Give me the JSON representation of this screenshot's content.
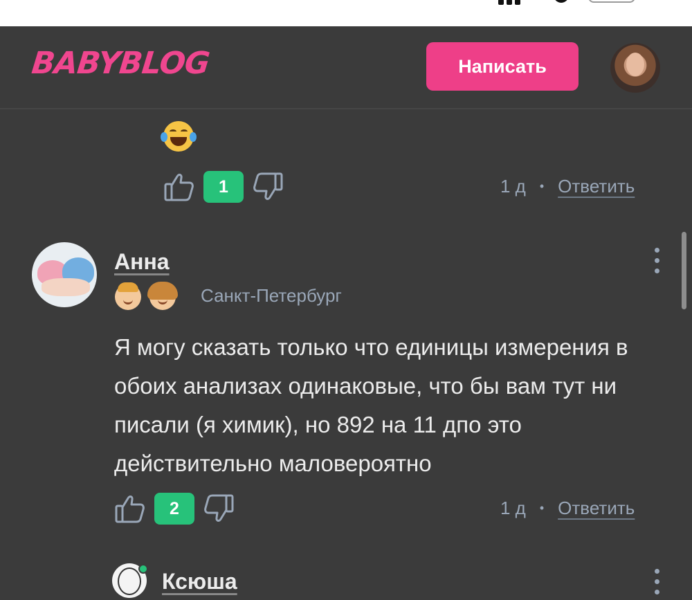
{
  "header": {
    "logo": "BABYBLOG",
    "write_button": "Написать",
    "accent_color": "#ee3f88"
  },
  "comments": [
    {
      "emoji": "face-with-tears-of-joy",
      "likes": "1",
      "age": "1 д",
      "reply": "Ответить"
    },
    {
      "author": "Анна",
      "city": "Санкт-Петербург",
      "kids": [
        "boy-icon",
        "girl-icon"
      ],
      "text": "Я могу сказать только что единицы измерения в обоих анализах одинаковые, что бы вам тут ни писали (я химик), но 892 на 11 дпо это действительно маловероятно",
      "likes": "2",
      "age": "1 д",
      "reply": "Ответить"
    },
    {
      "author": "Ксюша",
      "online": true
    }
  ],
  "colors": {
    "background": "#3b3b3b",
    "like_badge": "#27c27a",
    "muted": "#9aa7b8"
  }
}
